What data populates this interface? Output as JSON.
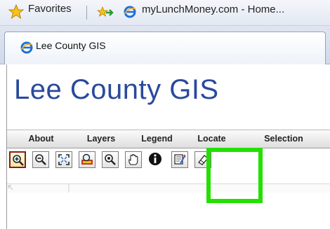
{
  "favorites_bar": {
    "favorites_label": "Favorites",
    "site_link": "myLunchMoney.com - Home..."
  },
  "tab": {
    "title": "Lee County GIS"
  },
  "page": {
    "title": "Lee County GIS",
    "menu": [
      "About",
      "Layers",
      "Legend",
      "Locate",
      "Selection"
    ],
    "tools": [
      {
        "icon": "zoom-in-icon",
        "active": true
      },
      {
        "icon": "zoom-out-icon",
        "active": false
      },
      {
        "icon": "full-extent-icon",
        "active": false
      },
      {
        "icon": "zoom-box-icon",
        "active": false
      },
      {
        "icon": "zoom-selection-icon",
        "active": false
      },
      {
        "icon": "pan-hand-icon",
        "active": false
      },
      {
        "icon": "identify-icon",
        "active": false
      },
      {
        "icon": "properties-icon",
        "active": false
      },
      {
        "icon": "eraser-icon",
        "active": false
      }
    ]
  },
  "annotation": {
    "highlight_color": "#22e000"
  }
}
